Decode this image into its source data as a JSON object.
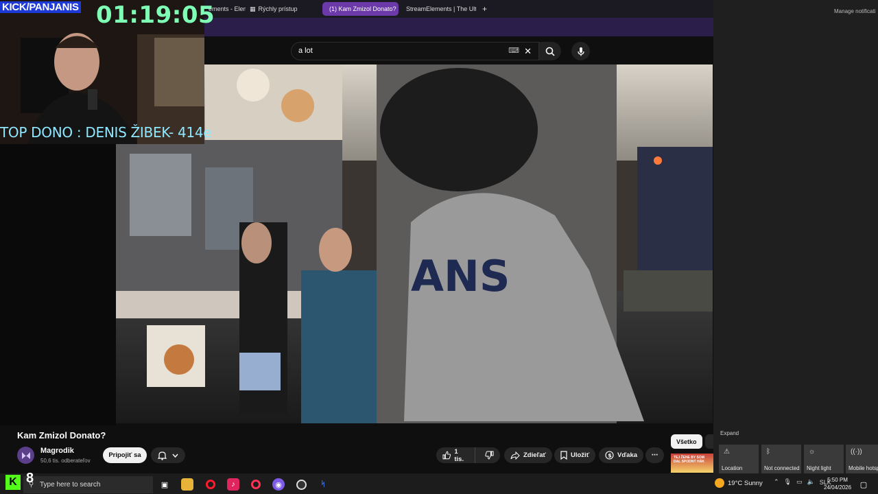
{
  "browser": {
    "tabs": [
      {
        "label": "ements - Element"
      },
      {
        "label": "Rýchly prístup"
      },
      {
        "label": "(1) Kam Zmizol Donato?"
      },
      {
        "label": "StreamElements | The Ulti"
      }
    ],
    "new_tab": "+"
  },
  "youtube": {
    "search_value": "a lot",
    "video_title": "Kam Zmizol Donato?",
    "channel_name": "Magrodik",
    "subscribers": "50,6 tis. odberateľov",
    "join_label": "Pripojiť sa",
    "like_count": "1 tis.",
    "share_label": "Zdieľať",
    "save_label": "Uložiť",
    "thanks_label": "Vďaka",
    "more_label": "⋯",
    "chip_all": "Všetko",
    "thumb_text": "TEJ ŽENE BY SOM DAL SPODNÝ HÁK"
  },
  "stream_overlay": {
    "channel_tag": "KICK/PANJANIS",
    "timer": "01:19:05",
    "top_dono": "TOP DONO : DENIS ŽIBEK- 414e"
  },
  "notifications": {
    "manage": "Manage notificati",
    "expand": "Expand",
    "tiles": [
      {
        "label": "Location",
        "icon": "location-icon"
      },
      {
        "label": "Not connected",
        "icon": "bluetooth-icon"
      },
      {
        "label": "Night light",
        "icon": "night-light-icon"
      },
      {
        "label": "Mobile hotsp",
        "icon": "hotspot-icon"
      }
    ]
  },
  "taskbar": {
    "kick_badge": "K",
    "badge_number": "8",
    "search_placeholder": "Type here to search",
    "weather": "19°C  Sunny",
    "language": "SLK",
    "time": "5:50 PM",
    "date": "24/04/2026"
  },
  "colors": {
    "accent_tab": "#6b3aa8",
    "kick_green": "#53fc18",
    "timer_green": "#7fffb5",
    "dono_cyan": "#8fe8ff"
  }
}
